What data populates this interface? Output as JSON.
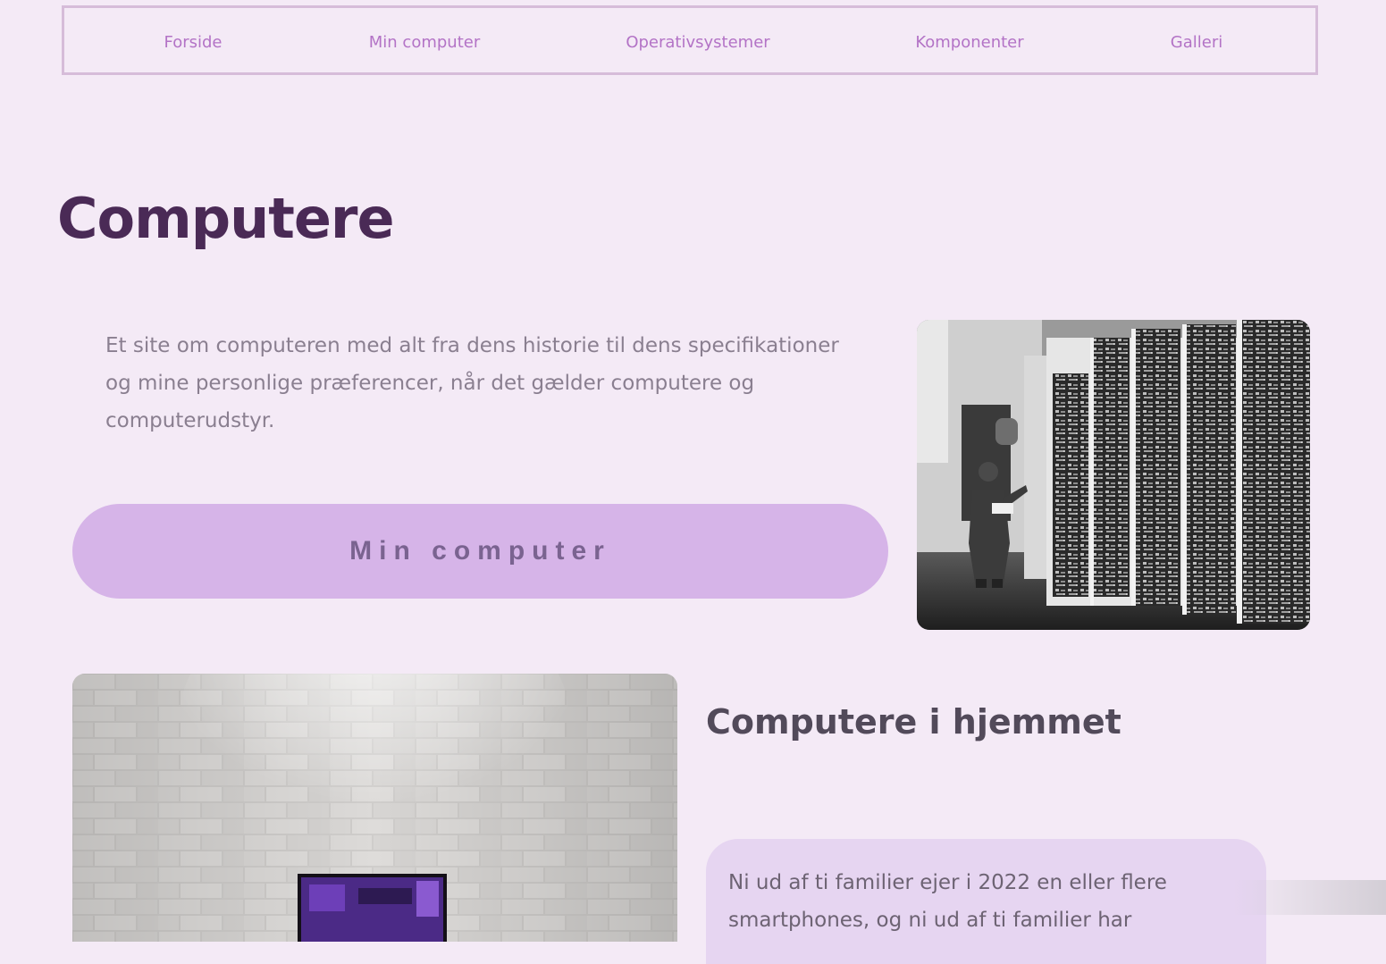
{
  "nav": {
    "items": [
      {
        "label": "Forside"
      },
      {
        "label": "Min computer"
      },
      {
        "label": "Operativsystemer"
      },
      {
        "label": "Komponenter"
      },
      {
        "label": "Galleri"
      }
    ]
  },
  "hero": {
    "title": "Computere",
    "intro": "Et site om computeren med alt fra dens historie til dens specifikationer og mine personlige præferencer, når det gælder computere og computerudstyr.",
    "cta_label": "Min computer"
  },
  "home_section": {
    "title": "Computere i hjemmet",
    "card_text": "Ni ud af ti familier ejer i 2022 en eller flere smartphones, og ni ud af ti familier har"
  },
  "colors": {
    "background": "#f4eaf6",
    "nav_text": "#b373c6",
    "title": "#4a2a56",
    "button": "#d6b4e8",
    "card": "#e6d5f1"
  }
}
